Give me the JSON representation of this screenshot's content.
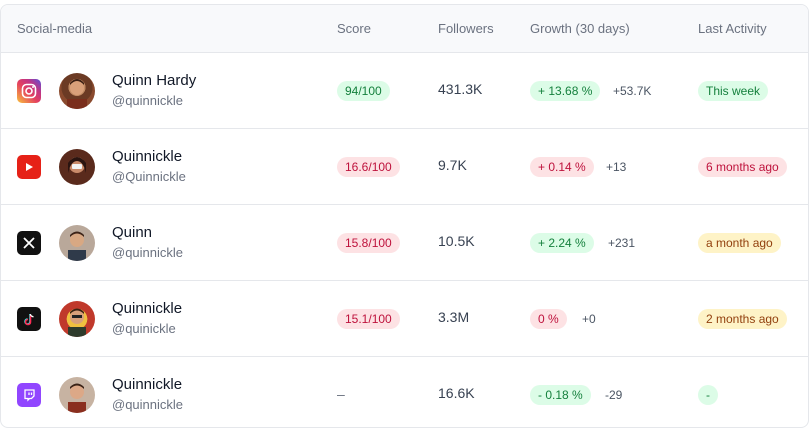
{
  "headers": {
    "social_media": "Social-media",
    "score": "Score",
    "followers": "Followers",
    "growth": "Growth (30 days)",
    "last_activity": "Last Activity"
  },
  "rows": [
    {
      "platform": "instagram",
      "platform_icon": "instagram-icon",
      "name": "Quinn Hardy",
      "handle": "@quinnickle",
      "score": "94/100",
      "score_status": "green",
      "followers": "431.3K",
      "growth_pct": "+ 13.68 %",
      "growth_status": "green",
      "growth_delta": "+53.7K",
      "last_activity": "This week",
      "activity_status": "green"
    },
    {
      "platform": "youtube",
      "platform_icon": "youtube-icon",
      "name": "Quinnickle",
      "handle": "@Quinnickle",
      "score": "16.6/100",
      "score_status": "red",
      "followers": "9.7K",
      "growth_pct": "+ 0.14 %",
      "growth_status": "red",
      "growth_delta": "+13",
      "last_activity": "6 months ago",
      "activity_status": "red"
    },
    {
      "platform": "x",
      "platform_icon": "x-icon",
      "name": "Quinn",
      "handle": "@quinnickle",
      "score": "15.8/100",
      "score_status": "red",
      "followers": "10.5K",
      "growth_pct": "+ 2.24 %",
      "growth_status": "green",
      "growth_delta": "+231",
      "last_activity": "a month ago",
      "activity_status": "yellow"
    },
    {
      "platform": "tiktok",
      "platform_icon": "tiktok-icon",
      "name": "Quinnickle",
      "handle": "@quinickle",
      "score": "15.1/100",
      "score_status": "red",
      "followers": "3.3M",
      "growth_pct": "0 %",
      "growth_status": "red",
      "growth_delta": "+0",
      "last_activity": "2 months ago",
      "activity_status": "yellow"
    },
    {
      "platform": "twitch",
      "platform_icon": "twitch-icon",
      "name": "Quinnickle",
      "handle": "@quinnickle",
      "score": "–",
      "score_status": "none",
      "followers": "16.6K",
      "growth_pct": "- 0.18 %",
      "growth_status": "green",
      "growth_delta": "-29",
      "last_activity": "-",
      "activity_status": "green"
    }
  ]
}
